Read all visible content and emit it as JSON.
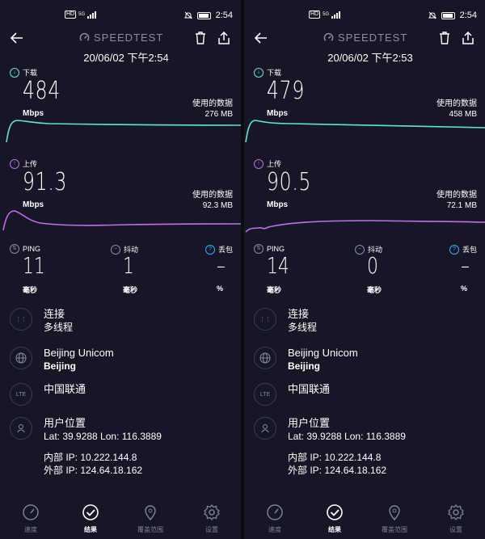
{
  "status": {
    "time": "2:54",
    "hd": "HD",
    "net": "5G"
  },
  "brand": "SPEEDTEST",
  "labels": {
    "download": "下载",
    "upload": "上传",
    "mbps": "Mbps",
    "used_data": "使用的数据",
    "ping": "PING",
    "jitter": "抖动",
    "loss": "丢包",
    "ms": "毫秒",
    "percent": "%",
    "connection_title": "连接",
    "connection_value": "多线程",
    "lte": "LTE",
    "location_title": "用户位置"
  },
  "nav": {
    "speed": "速度",
    "results": "结果",
    "coverage": "覆盖范围",
    "settings": "设置"
  },
  "left": {
    "datetime": "20/06/02 下午2:54",
    "download": "484",
    "download_used": "276 MB",
    "upload": "91.3",
    "upload_used": "92.3 MB",
    "ping": "11",
    "jitter": "1",
    "loss": "–",
    "isp": "Beijing Unicom",
    "city": "Beijing",
    "carrier": "中国联通",
    "latlon": "Lat: 39.9288 Lon: 116.3889",
    "internal_ip": "内部 IP: 10.222.144.8",
    "external_ip": "外部 IP: 124.64.18.162"
  },
  "right": {
    "datetime": "20/06/02 下午2:53",
    "download": "479",
    "download_used": "458 MB",
    "upload": "90.5",
    "upload_used": "72.1 MB",
    "ping": "14",
    "jitter": "0",
    "loss": "–",
    "isp": "Beijing Unicom",
    "city": "Beijing",
    "carrier": "中国联通",
    "latlon": "Lat: 39.9288 Lon: 116.3889",
    "internal_ip": "内部 IP: 10.222.144.8",
    "external_ip": "外部 IP: 124.64.18.162"
  },
  "colors": {
    "download": "#5ee6cf",
    "upload": "#c06ee8",
    "loss_icon": "#33b0ff",
    "bg": "#161626"
  }
}
